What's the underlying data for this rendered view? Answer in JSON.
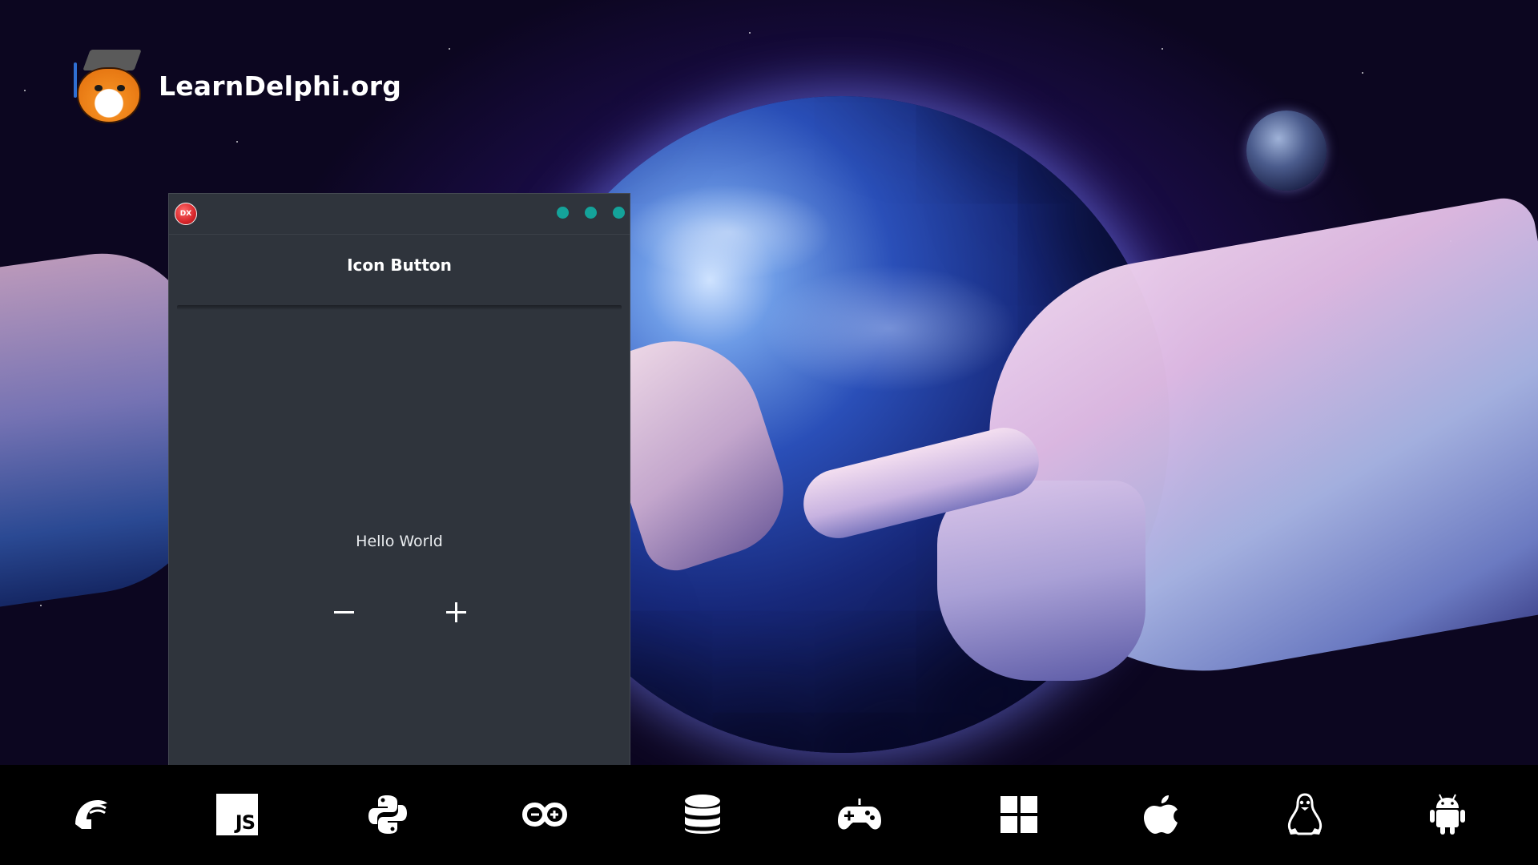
{
  "brand": {
    "site_name": "LearnDelphi.org",
    "logo_icon": "tiger-mascot-icon"
  },
  "window": {
    "app_icon_text": "DX",
    "app_icon_color": "#d8262b",
    "control_dots_color": "#14a39a",
    "control_dots": [
      "minimize-dot",
      "maximize-dot",
      "close-dot"
    ],
    "title": "Icon Button",
    "label": "Hello World",
    "minus_symbol": "−",
    "plus_symbol": "+",
    "background_color": "#2f343c"
  },
  "techbar": {
    "icons": [
      "delphi-helmet-icon",
      "javascript-icon",
      "python-icon",
      "arduino-icon",
      "database-icon",
      "gamepad-icon",
      "windows-icon",
      "apple-icon",
      "linux-tux-icon",
      "android-icon"
    ],
    "js_text": "JS"
  }
}
